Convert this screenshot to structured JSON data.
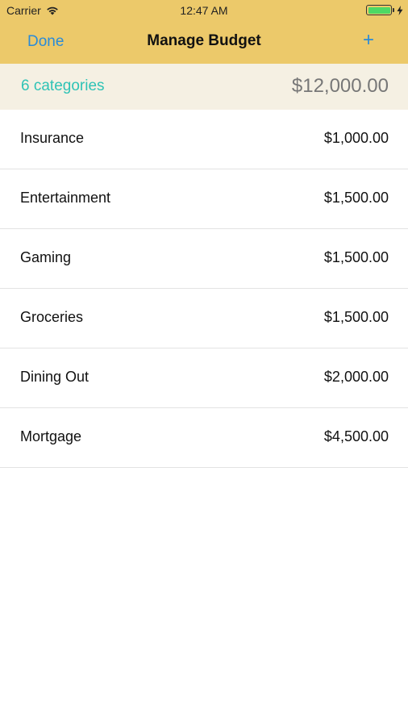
{
  "status_bar": {
    "carrier": "Carrier",
    "time": "12:47 AM",
    "battery_level": 1.0
  },
  "nav": {
    "done_label": "Done",
    "title": "Manage Budget",
    "add_label": "+"
  },
  "summary": {
    "count_text": "6 categories",
    "total": "$12,000.00"
  },
  "categories": [
    {
      "name": "Insurance",
      "amount": "$1,000.00"
    },
    {
      "name": "Entertainment",
      "amount": "$1,500.00"
    },
    {
      "name": "Gaming",
      "amount": "$1,500.00"
    },
    {
      "name": "Groceries",
      "amount": "$1,500.00"
    },
    {
      "name": "Dining Out",
      "amount": "$2,000.00"
    },
    {
      "name": "Mortgage",
      "amount": "$4,500.00"
    }
  ],
  "colors": {
    "header_bg": "#ecc96a",
    "accent_blue": "#2a8bd8",
    "accent_teal": "#2fc3b6",
    "summary_bg": "#f5f0e3",
    "battery_green": "#4cd964"
  },
  "icons": [
    "wifi-icon",
    "battery-icon",
    "charging-bolt-icon",
    "plus-icon"
  ]
}
